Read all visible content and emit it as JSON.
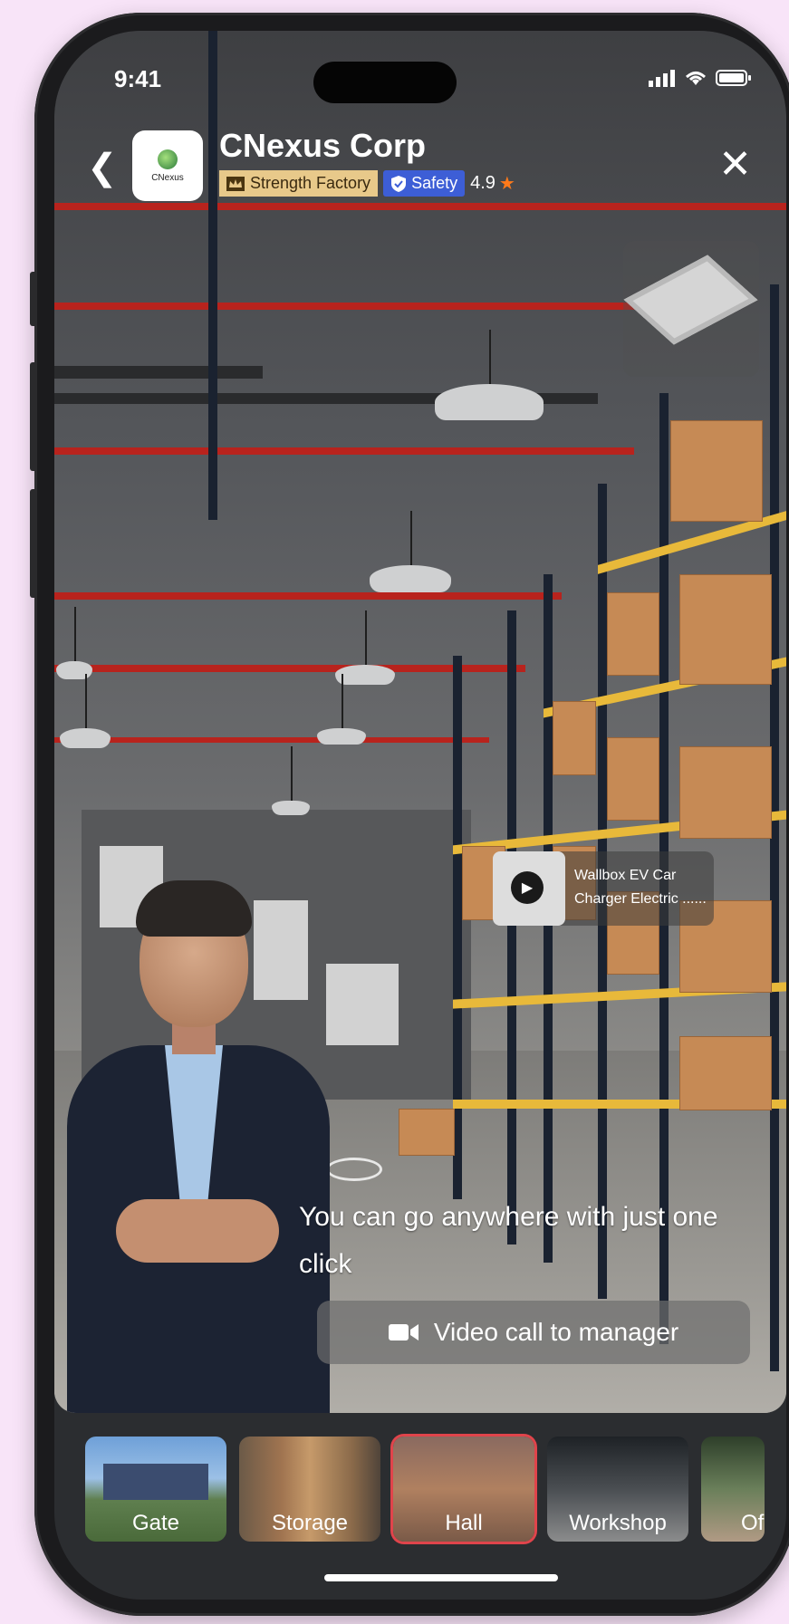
{
  "status_bar": {
    "time": "9:41"
  },
  "header": {
    "company_name": "CNexus Corp",
    "logo_text": "CNexus",
    "badge_strength": "Strength Factory",
    "badge_safety": "Safety",
    "rating": "4.9"
  },
  "product_card": {
    "title": "Wallbox EV Car Charger Electric ......"
  },
  "subtitle": "You can go anywhere with just one click",
  "video_call_label": "Video call to manager",
  "tabs": [
    {
      "label": "Gate"
    },
    {
      "label": "Storage"
    },
    {
      "label": "Hall"
    },
    {
      "label": "Workshop"
    },
    {
      "label": "Of"
    }
  ],
  "active_tab": "Hall",
  "colors": {
    "accent_red": "#e0444b",
    "safety_blue": "#3d5ed6",
    "strength_gold": "#e8c98a",
    "star_orange": "#ff7a1a"
  }
}
